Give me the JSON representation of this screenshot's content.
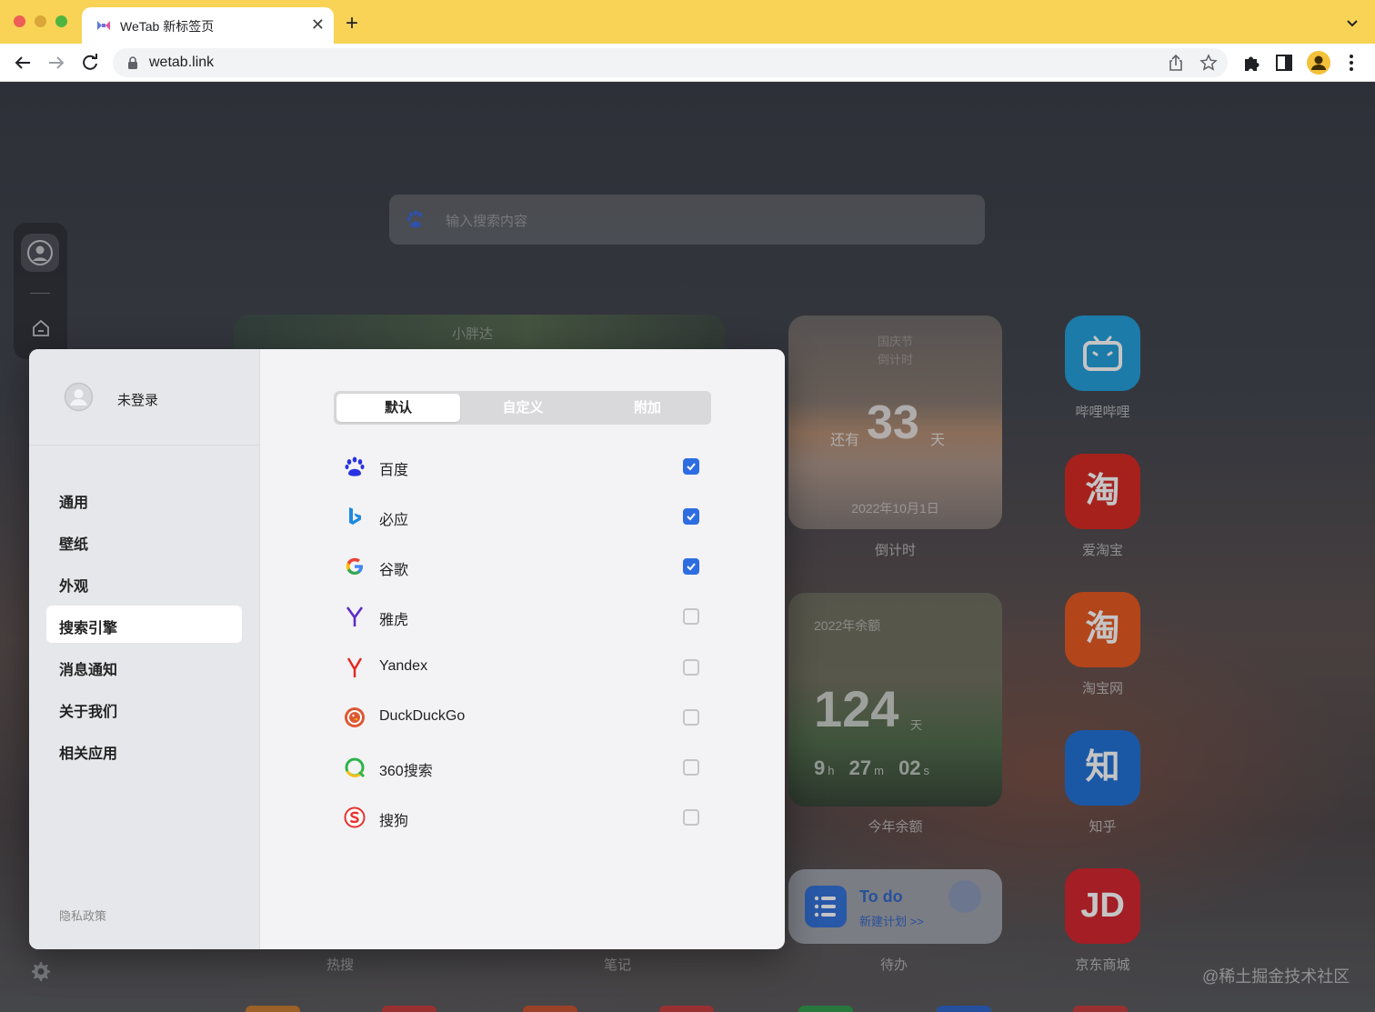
{
  "browser": {
    "tab_title": "WeTab 新标签页",
    "url": "wetab.link"
  },
  "search": {
    "placeholder": "输入搜索内容"
  },
  "widgets": {
    "weather_label": "小胖达",
    "countdown": {
      "title_line1": "国庆节",
      "title_line2": "倒计时",
      "prefix": "还有",
      "days": "33",
      "unit": "天",
      "date": "2022年10月1日",
      "caption": "倒计时"
    },
    "year_remaining": {
      "label": "2022年余额",
      "days": "124",
      "unit": "天",
      "hours": "9",
      "hours_unit": "h",
      "minutes": "27",
      "minutes_unit": "m",
      "seconds": "02",
      "seconds_unit": "s",
      "caption": "今年余额"
    },
    "todo": {
      "title": "To do",
      "subtitle": "新建计划 >>",
      "caption": "待办"
    }
  },
  "apps": [
    {
      "label": "哔哩哔哩",
      "color": "#1f9ed8",
      "glyph": ""
    },
    {
      "label": "爱淘宝",
      "color": "#d7261e",
      "glyph": "淘"
    },
    {
      "label": "淘宝网",
      "color": "#e7561b",
      "glyph": "淘"
    },
    {
      "label": "知乎",
      "color": "#1c6fd6",
      "glyph": "知"
    },
    {
      "label": "京东商城",
      "color": "#d5222a",
      "glyph": "JD"
    }
  ],
  "bottom_labels": {
    "hot": "热搜",
    "notes": "笔记"
  },
  "watermark": "@稀土掘金技术社区",
  "settings": {
    "user_name": "未登录",
    "nav": [
      "通用",
      "壁纸",
      "外观",
      "搜索引擎",
      "消息通知",
      "关于我们",
      "相关应用"
    ],
    "active_nav": "搜索引擎",
    "privacy": "隐私政策",
    "segments": [
      "默认",
      "自定义",
      "附加"
    ],
    "active_segment": "默认",
    "engines": [
      {
        "name": "百度",
        "checked": true,
        "icon": "baidu-icon"
      },
      {
        "name": "必应",
        "checked": true,
        "icon": "bing-icon"
      },
      {
        "name": "谷歌",
        "checked": true,
        "icon": "google-icon"
      },
      {
        "name": "雅虎",
        "checked": false,
        "icon": "yahoo-icon"
      },
      {
        "name": "Yandex",
        "checked": false,
        "icon": "yandex-icon"
      },
      {
        "name": "DuckDuckGo",
        "checked": false,
        "icon": "duckduckgo-icon"
      },
      {
        "name": "360搜索",
        "checked": false,
        "icon": "360-search-icon"
      },
      {
        "name": "搜狗",
        "checked": false,
        "icon": "sogou-icon"
      }
    ]
  },
  "colors": {
    "chrome_frame": "#f8d356",
    "accent": "#2e6de1"
  }
}
